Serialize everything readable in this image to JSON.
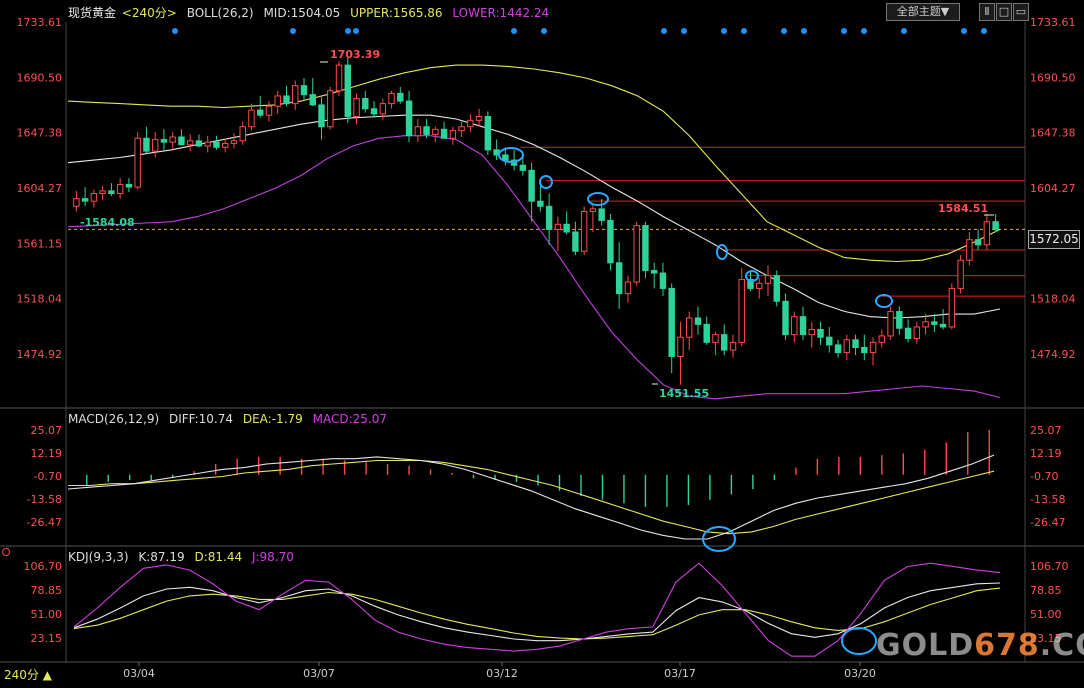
{
  "header": {
    "symbol": "现货黄金",
    "period": "<240分>",
    "boll": {
      "label": "BOLL(26,2)",
      "mid": "MID:1504.05",
      "upper": "UPPER:1565.86",
      "lower": "LOWER:1442.24"
    },
    "all_topics_btn": "全部主题▼",
    "win_btns": [
      "Ⅱ",
      "□",
      "▭"
    ]
  },
  "macd_header": {
    "label": "MACD(26,12,9)",
    "diff": "DIFF:10.74",
    "dea": "DEA:-1.79",
    "macd": "MACD:25.07"
  },
  "kdj_header": {
    "label": "KDJ(9,3,3)",
    "k": "K:87.19",
    "d": "D:81.44",
    "j": "J:98.70"
  },
  "current_price": "1572.05",
  "period_selector": "240分 ▲",
  "watermark": {
    "pre": "GOLD",
    "mid": "678",
    "post": ".COM"
  },
  "colors": {
    "up": "#ff4a4a",
    "down": "#2ed39a",
    "boll_band": "#e6e65a",
    "boll_mid": "#e8e8e8",
    "lower_band": "#c040e0",
    "macd_dea": "#e6e65a",
    "macd_diff": "#e8e8e8",
    "kdj_j": "#d040e0",
    "signal_dots": "#1e90ff",
    "circle": "#2aa8ff"
  },
  "chart_data": [
    {
      "type": "candlestick",
      "title": "现货黄金 240分",
      "x_labels": [
        "03/04",
        "03/07",
        "03/12",
        "03/17",
        "03/20"
      ],
      "y_ticks": [
        1733.61,
        1690.5,
        1647.38,
        1604.27,
        1561.15,
        1518.04,
        1474.92
      ],
      "ylim": [
        1448,
        1736
      ],
      "annotations": {
        "high": "1703.39",
        "low": "1451.55",
        "left_ref": "1584.08",
        "last_high": "1584.51"
      },
      "ohlc": [
        [
          1590,
          1602,
          1586,
          1596
        ],
        [
          1596,
          1605,
          1590,
          1594
        ],
        [
          1594,
          1603,
          1589,
          1600
        ],
        [
          1600,
          1606,
          1595,
          1602
        ],
        [
          1602,
          1608,
          1598,
          1600
        ],
        [
          1600,
          1612,
          1596,
          1607
        ],
        [
          1607,
          1612,
          1601,
          1605
        ],
        [
          1605,
          1648,
          1603,
          1643
        ],
        [
          1643,
          1652,
          1631,
          1633
        ],
        [
          1633,
          1648,
          1628,
          1642
        ],
        [
          1642,
          1650,
          1634,
          1640
        ],
        [
          1640,
          1648,
          1635,
          1644
        ],
        [
          1644,
          1650,
          1639,
          1638
        ],
        [
          1638,
          1646,
          1633,
          1641
        ],
        [
          1641,
          1646,
          1636,
          1637
        ],
        [
          1637,
          1645,
          1632,
          1640
        ],
        [
          1640,
          1645,
          1634,
          1636
        ],
        [
          1636,
          1643,
          1632,
          1639
        ],
        [
          1639,
          1647,
          1635,
          1641
        ],
        [
          1641,
          1656,
          1638,
          1652
        ],
        [
          1652,
          1670,
          1649,
          1665
        ],
        [
          1665,
          1676,
          1659,
          1661
        ],
        [
          1661,
          1672,
          1656,
          1668
        ],
        [
          1668,
          1680,
          1662,
          1676
        ],
        [
          1676,
          1684,
          1668,
          1670
        ],
        [
          1670,
          1688,
          1665,
          1684
        ],
        [
          1684,
          1690,
          1673,
          1677
        ],
        [
          1677,
          1690,
          1668,
          1669
        ],
        [
          1669,
          1675,
          1642,
          1652
        ],
        [
          1652,
          1683,
          1650,
          1680
        ],
        [
          1680,
          1703,
          1676,
          1700
        ],
        [
          1700,
          1706,
          1655,
          1660
        ],
        [
          1660,
          1678,
          1654,
          1674
        ],
        [
          1674,
          1680,
          1663,
          1666
        ],
        [
          1666,
          1672,
          1659,
          1662
        ],
        [
          1662,
          1674,
          1657,
          1670
        ],
        [
          1670,
          1680,
          1666,
          1678
        ],
        [
          1678,
          1683,
          1670,
          1672
        ],
        [
          1672,
          1680,
          1640,
          1645
        ],
        [
          1645,
          1658,
          1640,
          1652
        ],
        [
          1652,
          1658,
          1643,
          1646
        ],
        [
          1646,
          1652,
          1640,
          1650
        ],
        [
          1650,
          1656,
          1644,
          1643
        ],
        [
          1643,
          1652,
          1638,
          1649
        ],
        [
          1649,
          1656,
          1644,
          1652
        ],
        [
          1652,
          1662,
          1648,
          1657
        ],
        [
          1657,
          1666,
          1652,
          1660
        ],
        [
          1660,
          1664,
          1630,
          1634
        ],
        [
          1634,
          1642,
          1626,
          1630
        ],
        [
          1630,
          1636,
          1622,
          1626
        ],
        [
          1626,
          1634,
          1618,
          1622
        ],
        [
          1622,
          1630,
          1614,
          1618
        ],
        [
          1618,
          1624,
          1578,
          1594
        ],
        [
          1594,
          1606,
          1586,
          1590
        ],
        [
          1590,
          1600,
          1560,
          1572
        ],
        [
          1572,
          1582,
          1555,
          1576
        ],
        [
          1576,
          1586,
          1568,
          1570
        ],
        [
          1570,
          1578,
          1552,
          1555
        ],
        [
          1555,
          1590,
          1552,
          1586
        ],
        [
          1586,
          1592,
          1570,
          1588
        ],
        [
          1588,
          1596,
          1575,
          1579
        ],
        [
          1579,
          1584,
          1540,
          1546
        ],
        [
          1546,
          1562,
          1510,
          1522
        ],
        [
          1522,
          1536,
          1515,
          1531
        ],
        [
          1531,
          1578,
          1528,
          1575
        ],
        [
          1575,
          1578,
          1534,
          1540
        ],
        [
          1540,
          1546,
          1526,
          1538
        ],
        [
          1538,
          1546,
          1520,
          1526
        ],
        [
          1526,
          1530,
          1460,
          1473
        ],
        [
          1473,
          1500,
          1451,
          1488
        ],
        [
          1488,
          1508,
          1478,
          1503
        ],
        [
          1503,
          1512,
          1490,
          1498
        ],
        [
          1498,
          1504,
          1482,
          1484
        ],
        [
          1484,
          1492,
          1474,
          1490
        ],
        [
          1490,
          1498,
          1474,
          1478
        ],
        [
          1478,
          1490,
          1472,
          1484
        ],
        [
          1484,
          1542,
          1481,
          1533
        ],
        [
          1533,
          1540,
          1524,
          1526
        ],
        [
          1526,
          1534,
          1518,
          1530
        ],
        [
          1530,
          1544,
          1520,
          1536
        ],
        [
          1536,
          1540,
          1512,
          1516
        ],
        [
          1516,
          1522,
          1486,
          1490
        ],
        [
          1490,
          1508,
          1484,
          1504
        ],
        [
          1504,
          1512,
          1486,
          1490
        ],
        [
          1490,
          1500,
          1480,
          1494
        ],
        [
          1494,
          1500,
          1482,
          1488
        ],
        [
          1488,
          1496,
          1476,
          1482
        ],
        [
          1482,
          1486,
          1472,
          1476
        ],
        [
          1476,
          1490,
          1470,
          1486
        ],
        [
          1486,
          1490,
          1474,
          1480
        ],
        [
          1480,
          1490,
          1470,
          1476
        ],
        [
          1476,
          1488,
          1466,
          1484
        ],
        [
          1484,
          1494,
          1480,
          1489
        ],
        [
          1489,
          1512,
          1486,
          1508
        ],
        [
          1508,
          1512,
          1490,
          1495
        ],
        [
          1495,
          1502,
          1484,
          1487
        ],
        [
          1487,
          1500,
          1483,
          1496
        ],
        [
          1496,
          1506,
          1490,
          1500
        ],
        [
          1500,
          1506,
          1492,
          1498
        ],
        [
          1498,
          1510,
          1494,
          1496
        ],
        [
          1496,
          1530,
          1494,
          1526
        ],
        [
          1526,
          1552,
          1522,
          1548
        ],
        [
          1548,
          1570,
          1544,
          1564
        ],
        [
          1564,
          1572,
          1556,
          1560
        ],
        [
          1560,
          1584,
          1556,
          1578
        ],
        [
          1578,
          1584,
          1570,
          1572
        ]
      ],
      "boll_upper": [
        1672,
        1671,
        1670,
        1669,
        1668,
        1668,
        1667,
        1668,
        1669,
        1672,
        1677,
        1683,
        1689,
        1694,
        1698,
        1700,
        1700,
        1699,
        1697,
        1694,
        1690,
        1684,
        1676,
        1664,
        1645,
        1622,
        1600,
        1578,
        1568,
        1558,
        1550,
        1548,
        1547,
        1548,
        1553,
        1562,
        1572
      ],
      "boll_mid": [
        1624,
        1626,
        1628,
        1631,
        1634,
        1638,
        1642,
        1646,
        1650,
        1654,
        1657,
        1659,
        1660,
        1661,
        1661,
        1658,
        1652,
        1646,
        1638,
        1628,
        1617,
        1605,
        1594,
        1582,
        1571,
        1560,
        1547,
        1536,
        1526,
        1515,
        1508,
        1504,
        1503,
        1504,
        1506,
        1506,
        1510
      ],
      "boll_lower": [
        1574,
        1575,
        1576,
        1577,
        1578,
        1582,
        1588,
        1596,
        1604,
        1614,
        1627,
        1637,
        1643,
        1645,
        1645,
        1642,
        1630,
        1606,
        1578,
        1550,
        1520,
        1492,
        1470,
        1451,
        1442,
        1440,
        1442,
        1444,
        1444,
        1444,
        1444,
        1446,
        1448,
        1450,
        1448,
        1446,
        1441
      ],
      "resistance_lines": [
        1636,
        1610,
        1594,
        1556,
        1536,
        1520
      ],
      "dashed_ref_line": 1572.05
    },
    {
      "type": "macd",
      "y_ticks": [
        25.07,
        12.19,
        -0.7,
        -13.58,
        -26.47
      ],
      "ylim": [
        -38,
        30
      ],
      "diff": [
        -8,
        -7,
        -6,
        -5,
        -3,
        -1,
        1,
        3,
        4,
        6,
        7,
        8,
        9,
        9,
        10,
        9,
        8,
        6,
        3,
        -1,
        -5,
        -9,
        -14,
        -19,
        -23,
        -27,
        -31,
        -34,
        -36,
        -36,
        -32,
        -26,
        -20,
        -16,
        -13,
        -11,
        -9,
        -7,
        -5,
        -2,
        2,
        6,
        11
      ],
      "dea": [
        -6,
        -6,
        -5,
        -5,
        -4,
        -3,
        -2,
        -1,
        1,
        2,
        3,
        5,
        6,
        7,
        8,
        8,
        8,
        7,
        5,
        3,
        0,
        -3,
        -6,
        -10,
        -14,
        -18,
        -22,
        -26,
        -29,
        -32,
        -33,
        -32,
        -29,
        -25,
        -22,
        -19,
        -16,
        -13,
        -10,
        -7,
        -4,
        -1,
        2
      ],
      "macd_hist": [
        -6,
        -4,
        -3,
        -3,
        -2,
        2,
        6,
        9,
        10,
        10,
        9,
        9,
        8,
        7,
        6,
        5,
        3,
        1,
        -2,
        -3,
        -4,
        -6,
        -9,
        -12,
        -14,
        -16,
        -18,
        -18,
        -17,
        -14,
        -11,
        -8,
        -3,
        4,
        9,
        10,
        10,
        11,
        12,
        14,
        18,
        24,
        25
      ]
    },
    {
      "type": "kdj",
      "y_ticks": [
        106.7,
        78.85,
        51.0,
        23.15
      ],
      "ylim": [
        -8,
        112
      ],
      "k": [
        35,
        45,
        58,
        72,
        80,
        82,
        78,
        70,
        64,
        70,
        78,
        80,
        72,
        60,
        50,
        42,
        35,
        30,
        26,
        22,
        20,
        20,
        22,
        25,
        28,
        30,
        55,
        70,
        65,
        55,
        40,
        28,
        24,
        28,
        40,
        58,
        70,
        78,
        82,
        86,
        87
      ],
      "d": [
        34,
        38,
        46,
        56,
        66,
        72,
        74,
        72,
        68,
        68,
        72,
        76,
        74,
        68,
        60,
        52,
        45,
        39,
        34,
        29,
        25,
        23,
        22,
        23,
        25,
        27,
        38,
        50,
        56,
        56,
        50,
        42,
        35,
        32,
        34,
        42,
        52,
        62,
        70,
        78,
        81
      ],
      "j": [
        36,
        58,
        82,
        104,
        108,
        102,
        86,
        66,
        56,
        74,
        90,
        88,
        68,
        44,
        30,
        22,
        16,
        12,
        10,
        8,
        10,
        14,
        22,
        30,
        34,
        36,
        88,
        110,
        84,
        52,
        20,
        2,
        2,
        20,
        52,
        90,
        106,
        110,
        106,
        102,
        99
      ]
    }
  ]
}
